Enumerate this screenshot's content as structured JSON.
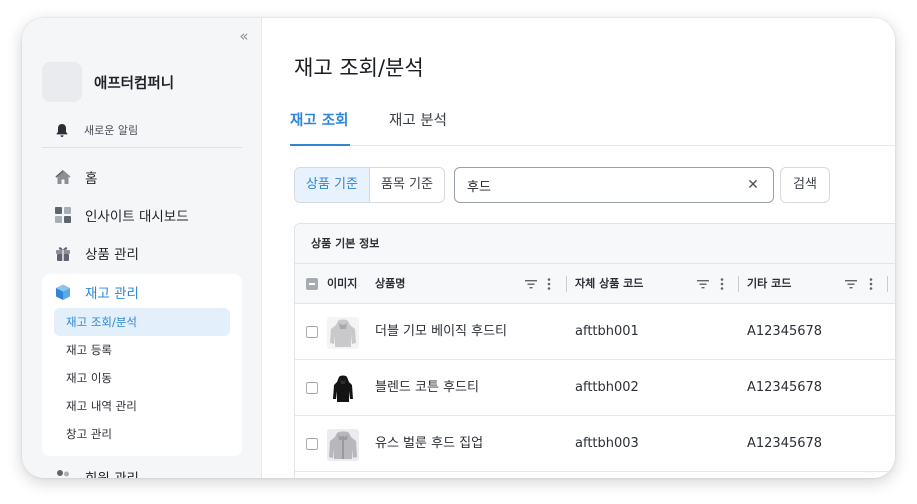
{
  "company": {
    "name": "애프터컴퍼니"
  },
  "sidebar": {
    "notice_label": "새로운 알림",
    "home_label": "홈",
    "insight_label": "인사이트 대시보드",
    "product_label": "상품 관리",
    "inventory_label": "재고 관리",
    "inventory_sub": [
      "재고 조회/분석",
      "재고 등록",
      "재고 이동",
      "재고 내역 관리",
      "창고 관리"
    ],
    "member_label": "회원 관리"
  },
  "page": {
    "title": "재고 조회/분석"
  },
  "tabs": [
    "재고 조회",
    "재고 분석"
  ],
  "filter": {
    "segments": [
      "상품 기준",
      "품목 기준"
    ],
    "search_value": "후드",
    "search_button": "검색"
  },
  "table": {
    "group_header": "상품 기본 정보",
    "columns": [
      "이미지",
      "상품명",
      "자체 상품 코드",
      "기타 코드"
    ],
    "rows": [
      {
        "name": "더블 기모 베이직 후드티",
        "code": "afttbh001",
        "other": "A12345678",
        "thumb_color": "#c9c9cc"
      },
      {
        "name": "블렌드 코튼 후드티",
        "code": "afttbh002",
        "other": "A12345678",
        "thumb_color": "#141414"
      },
      {
        "name": "유스 벌룬 후드 집업",
        "code": "afttbh003",
        "other": "A12345678",
        "thumb_color": "#b8b8bc"
      }
    ]
  },
  "colors": {
    "accent": "#2f86d6",
    "sidebar_bg": "#f5f6f8",
    "active_bg": "#e3f0fc"
  }
}
